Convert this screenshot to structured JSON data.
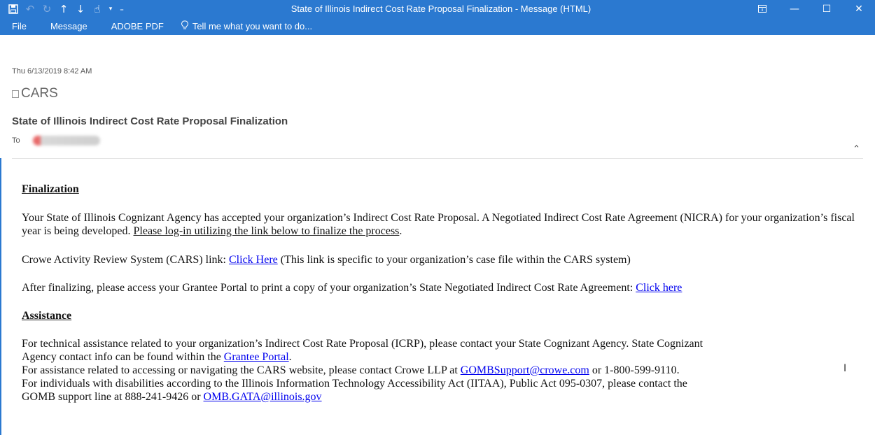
{
  "window": {
    "title": "State of Illinois Indirect Cost Rate Proposal Finalization - Message (HTML)",
    "qat_icons": [
      "save-icon",
      "undo-icon",
      "redo-icon",
      "up-arrow-icon",
      "down-arrow-icon",
      "touch-mode-icon",
      "customize-dropdown-icon"
    ]
  },
  "ribbon": {
    "tabs": [
      "File",
      "Message",
      "ADOBE PDF"
    ],
    "tell_me": "Tell me what you want to do..."
  },
  "header": {
    "date": "Thu 6/13/2019 8:42 AM",
    "sender": "CARS",
    "subject": "State of Illinois Indirect Cost Rate Proposal Finalization",
    "to_label": "To"
  },
  "body": {
    "finalization_heading": "Finalization",
    "p1_text": "Your State of Illinois Cognizant Agency has accepted your organization’s Indirect Cost Rate Proposal. A Negotiated Indirect Cost Rate Agreement (NICRA) for your organization’s fiscal year is being developed. ",
    "p1_underlined": "Please log-in utilizing the link below to finalize the process",
    "p1_end": ".",
    "p2_prefix": "Crowe Activity Review System (CARS) link: ",
    "p2_link": "Click Here",
    "p2_suffix": " (This link is specific to your organization’s case file within the CARS system)",
    "p3_prefix": "After finalizing, please access your Grantee Portal to print a copy of your organization’s State Negotiated Indirect Cost Rate Agreement: ",
    "p3_link": "Click here",
    "assistance_heading": "Assistance",
    "a1_line1": "For technical assistance related to your organization’s Indirect Cost Rate Proposal (ICRP), please contact your State Cognizant Agency. State Cognizant",
    "a1_line2_prefix": "Agency contact info can be found within the ",
    "a1_link": "Grantee Portal",
    "a1_line2_suffix": ".",
    "a2_prefix": "For assistance related to accessing or navigating the CARS website, please contact Crowe LLP at ",
    "a2_link": "GOMBSupport@crowe.com",
    "a2_suffix": " or 1-800-599-9110.",
    "a3_line1": "For individuals with disabilities according to the Illinois Information Technology Accessibility Act (IITAA), Public Act 095-0307, please contact the",
    "a3_line2_prefix": "GOMB support line at 888-241-9426 or ",
    "a3_link": "OMB.GATA@illinois.gov"
  }
}
